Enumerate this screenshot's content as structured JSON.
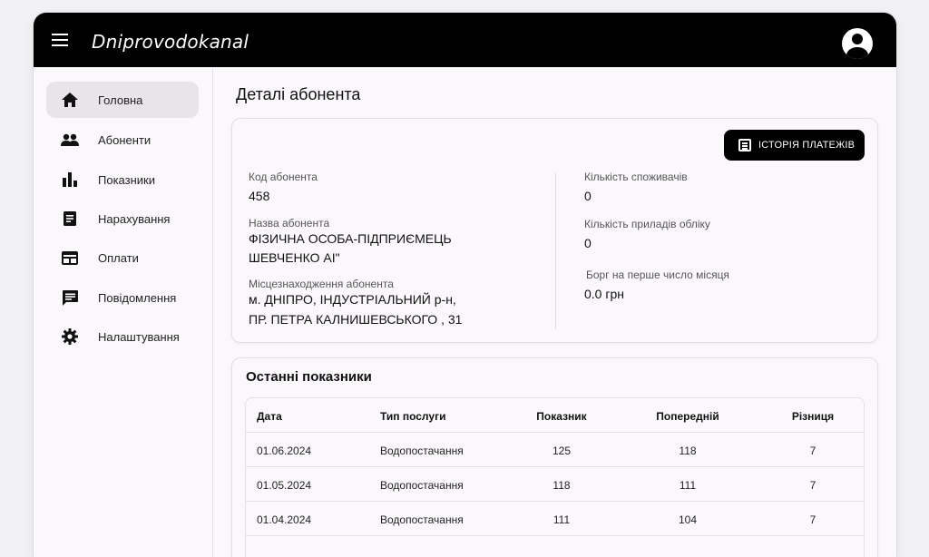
{
  "app": {
    "title": "Dniprovodokanal"
  },
  "sidebar": {
    "items": [
      {
        "label": "Головна",
        "icon": "home-icon"
      },
      {
        "label": "Абоненти",
        "icon": "people-icon"
      },
      {
        "label": "Показники",
        "icon": "bar-chart-icon"
      },
      {
        "label": "Нарахування",
        "icon": "receipt-icon"
      },
      {
        "label": "Оплати",
        "icon": "payment-icon"
      },
      {
        "label": "Повідомлення",
        "icon": "message-icon"
      },
      {
        "label": "Налаштування",
        "icon": "gear-icon"
      }
    ],
    "active_index": 0
  },
  "page": {
    "title": "Деталі абонента"
  },
  "details": {
    "history_button": "ІСТОРІЯ ПЛАТЕЖІВ",
    "code_label": "Код абонента",
    "code_value": "458",
    "name_label": "Назва абонента",
    "name_line1": "ФІЗИЧНА ОСОБА-ПІДПРИЄМЕЦЬ",
    "name_line2": "ШЕВЧЕНКО АІ\"",
    "location_label": "Місцезнаходження абонента",
    "location_line1": "м. ДНІПРО, ІНДУСТРІАЛЬНИЙ р-н,",
    "location_line2": "ПР. ПЕТРА КАЛНИШЕВСЬКОГО , 31",
    "consumers_label": "Кількість споживачів",
    "consumers_value": "0",
    "meters_label": "Кількість приладів обліку",
    "meters_value": "0",
    "debt_label": "Борг на перше число місяця",
    "debt_value": "0.0 грн"
  },
  "readings": {
    "title": "Останні показники",
    "columns": [
      "Дата",
      "Тип послуги",
      "Показник",
      "Попередній",
      "Різниця"
    ],
    "rows": [
      [
        "01.06.2024",
        "Водопостачання",
        "125",
        "118",
        "7"
      ],
      [
        "01.05.2024",
        "Водопостачання",
        "118",
        "111",
        "7"
      ],
      [
        "01.04.2024",
        "Водопостачання",
        "111",
        "104",
        "7"
      ]
    ]
  },
  "colors": {
    "appbar": "#000000",
    "active_nav": "#e8e4ea",
    "background": "#fbf8fc"
  }
}
